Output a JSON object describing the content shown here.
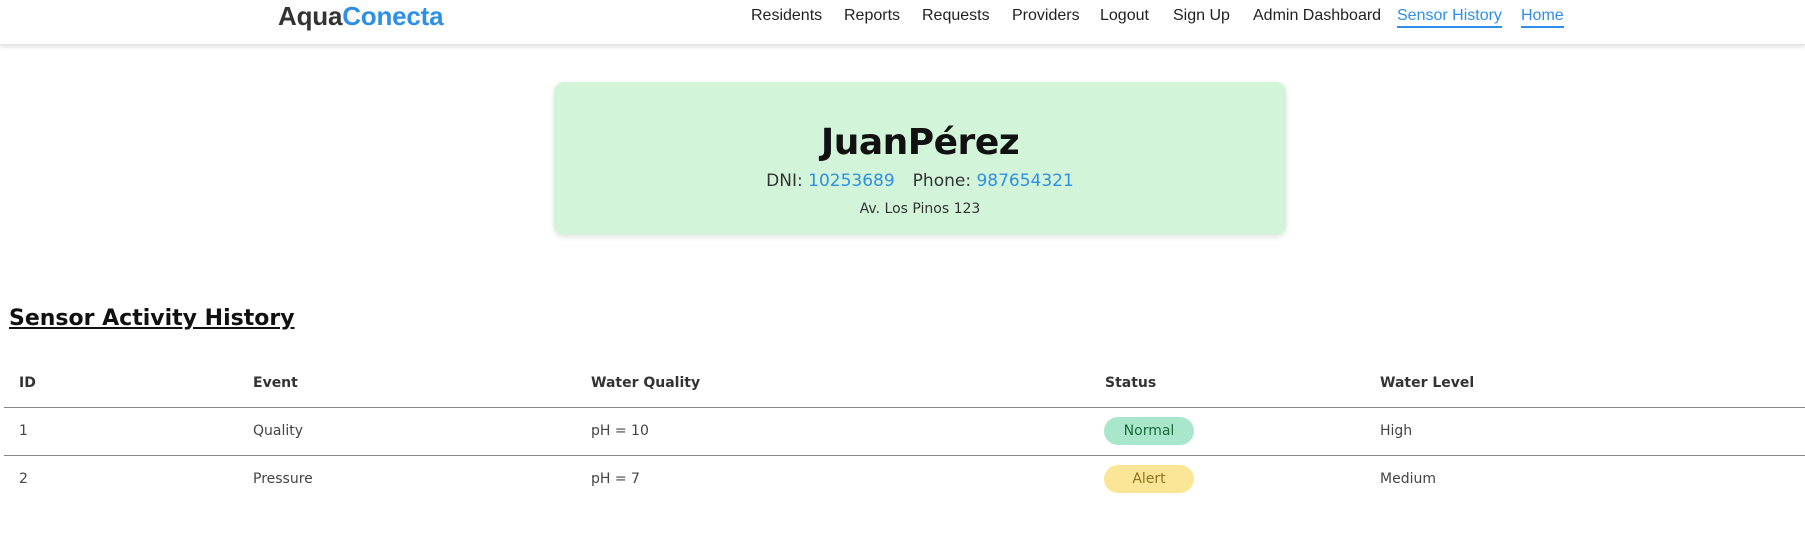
{
  "brand": {
    "part_a": "Aqua",
    "part_b": "Conecta"
  },
  "nav": [
    {
      "label": "Residents",
      "active": false
    },
    {
      "label": "Reports",
      "active": false
    },
    {
      "label": "Requests",
      "active": false
    },
    {
      "label": "Providers",
      "active": false
    },
    {
      "label": "Logout",
      "active": false
    },
    {
      "label": "Sign Up",
      "active": false
    },
    {
      "label": "Admin Dashboard",
      "active": false
    },
    {
      "label": "Sensor History",
      "active": true
    },
    {
      "label": "Home",
      "active": true
    }
  ],
  "resident": {
    "name": "JuanPérez",
    "dni_label": "DNI:",
    "dni": "10253689",
    "phone_label": "Phone:",
    "phone": "987654321",
    "address": "Av. Los Pinos 123"
  },
  "section_title": "Sensor Activity History",
  "table": {
    "headers": [
      "ID",
      "Event",
      "Water Quality",
      "Status",
      "Water Level"
    ],
    "rows": [
      {
        "id": "1",
        "event": "Quality",
        "quality": "pH = 10",
        "status": "Normal",
        "level": "High"
      },
      {
        "id": "2",
        "event": "Pressure",
        "quality": "pH = 7",
        "status": "Alert",
        "level": "Medium"
      }
    ]
  },
  "colors": {
    "accent": "#2e8fe6",
    "card_bg": "#d2f4d8",
    "status_normal": "#a9e7cc",
    "status_alert": "#fbe697"
  }
}
